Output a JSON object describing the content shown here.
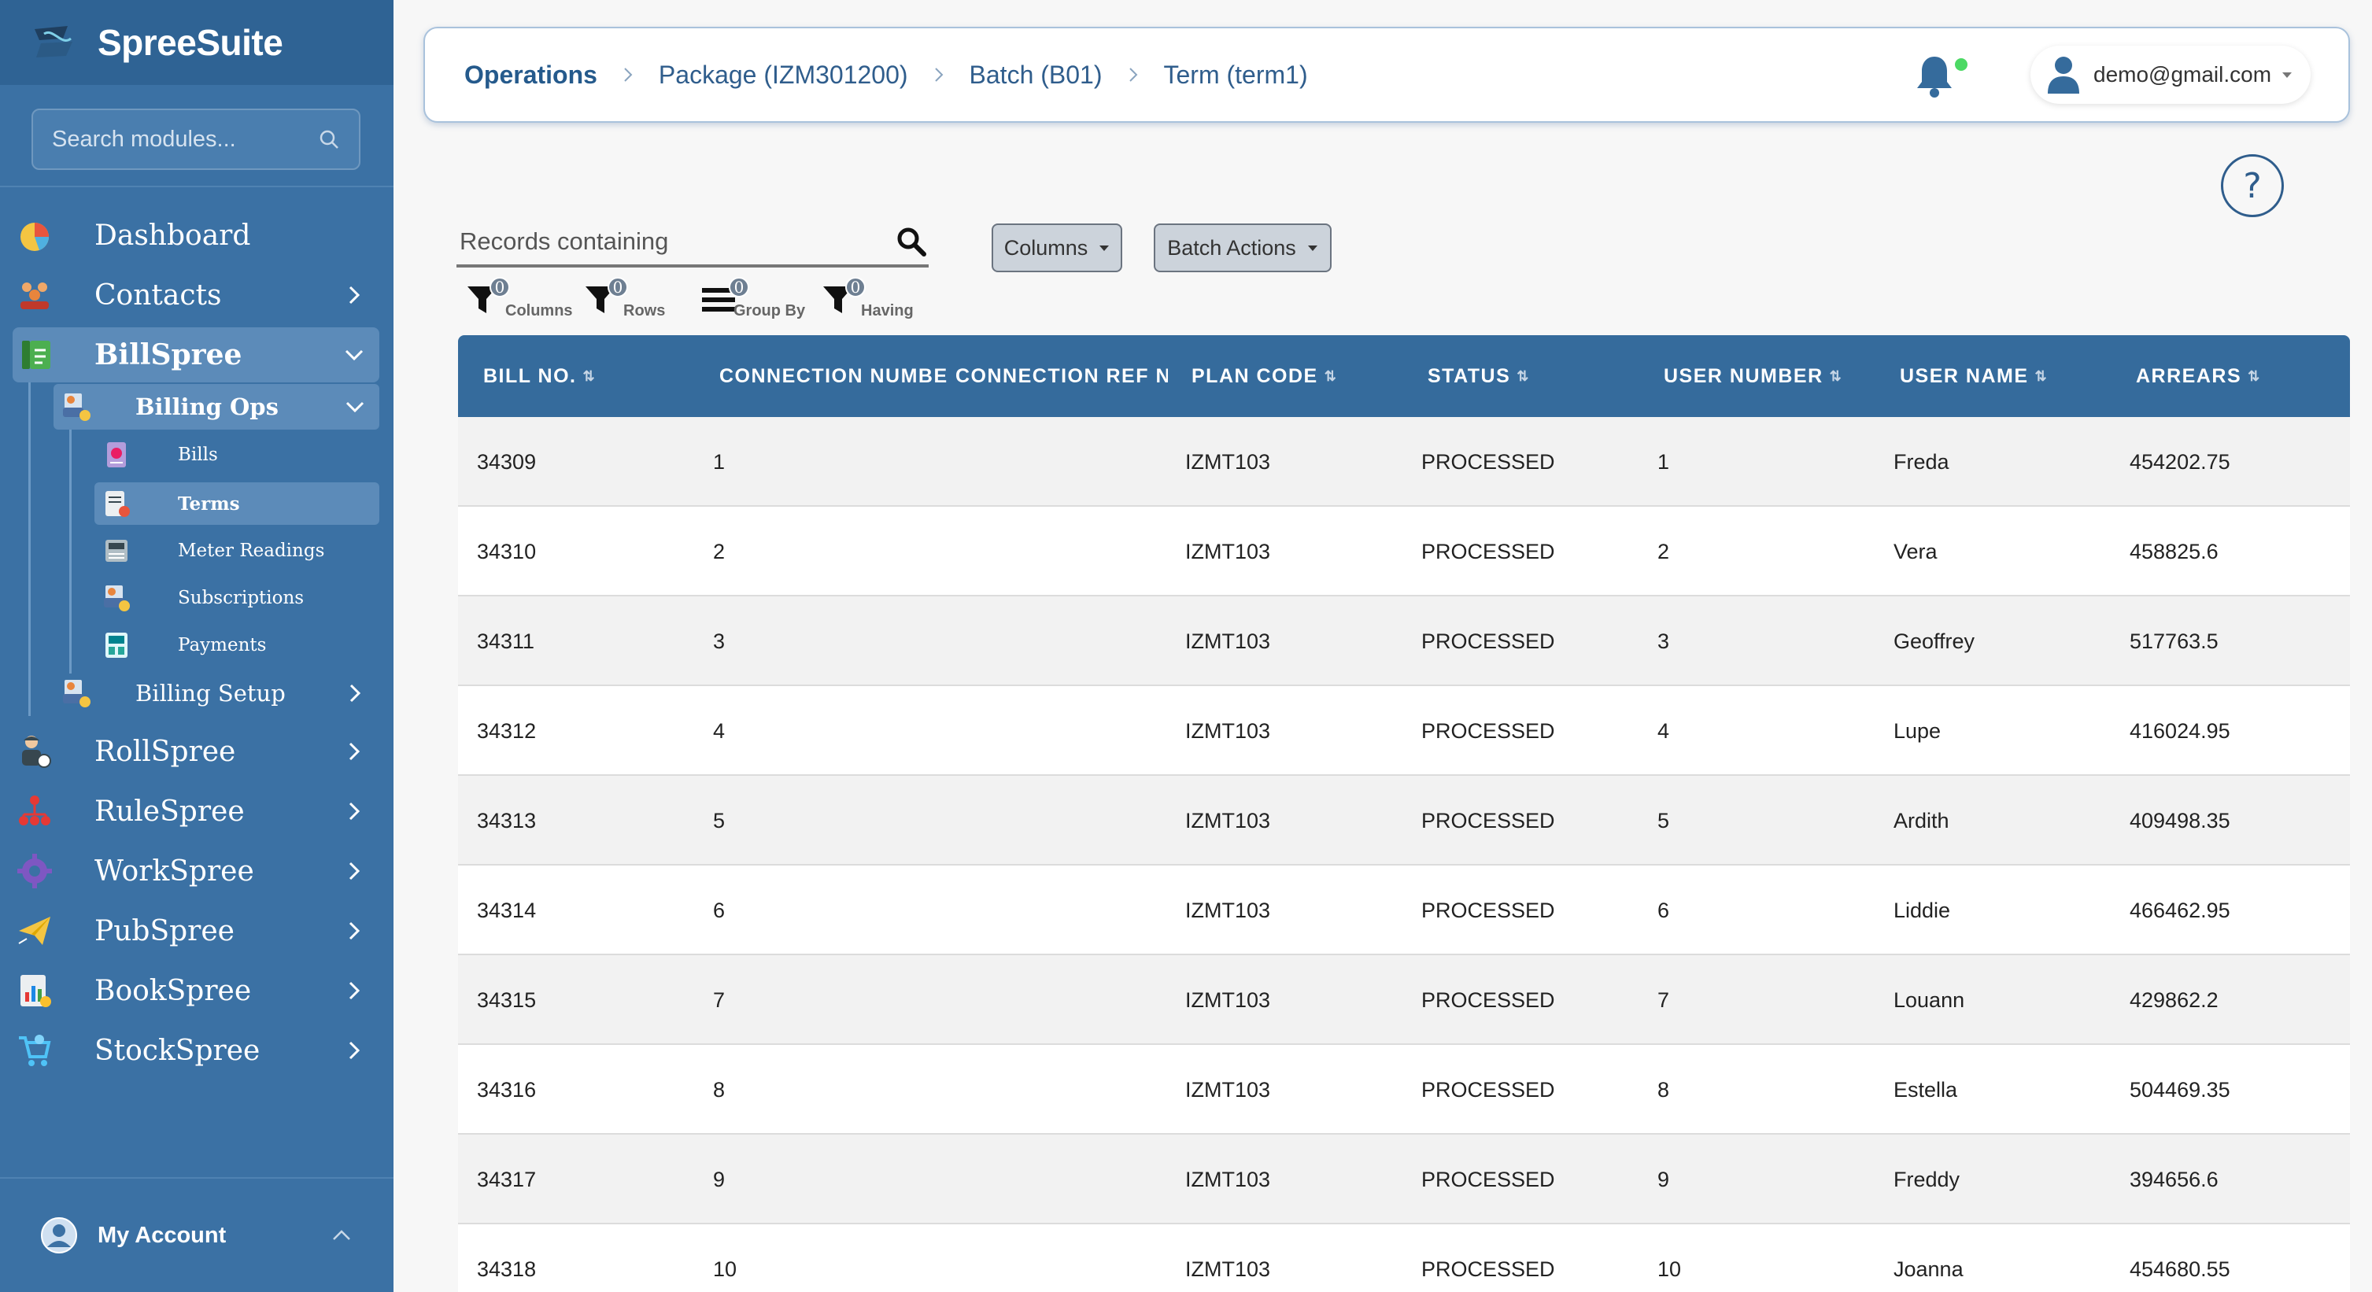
{
  "app": {
    "name": "SpreeSuite"
  },
  "sidebar": {
    "search_placeholder": "Search modules...",
    "items": [
      {
        "label": "Dashboard",
        "icon": "pie-chart-icon",
        "expandable": false
      },
      {
        "label": "Contacts",
        "icon": "people-icon",
        "expandable": true
      },
      {
        "label": "BillSpree",
        "icon": "bill-document-icon",
        "expandable": true,
        "expanded": true
      },
      {
        "label": "RollSpree",
        "icon": "user-roll-icon",
        "expandable": true
      },
      {
        "label": "RuleSpree",
        "icon": "hierarchy-icon",
        "expandable": true
      },
      {
        "label": "WorkSpree",
        "icon": "gear-team-icon",
        "expandable": true
      },
      {
        "label": "PubSpree",
        "icon": "paper-plane-icon",
        "expandable": true
      },
      {
        "label": "BookSpree",
        "icon": "ledger-chart-icon",
        "expandable": true
      },
      {
        "label": "StockSpree",
        "icon": "cart-icon",
        "expandable": true
      }
    ],
    "billspree_children": [
      {
        "label": "Billing Ops",
        "icon": "billing-ops-icon",
        "expanded": true
      },
      {
        "label": "Billing Setup",
        "icon": "billing-setup-icon",
        "expanded": false
      }
    ],
    "billing_ops_children": [
      {
        "label": "Bills",
        "icon": "bills-icon"
      },
      {
        "label": "Terms",
        "icon": "terms-icon",
        "active": true
      },
      {
        "label": "Meter Readings",
        "icon": "meter-icon"
      },
      {
        "label": "Subscriptions",
        "icon": "subscriptions-icon"
      },
      {
        "label": "Payments",
        "icon": "payments-icon"
      }
    ],
    "account_label": "My Account"
  },
  "header": {
    "breadcrumbs": [
      "Operations",
      "Package (IZM301200)",
      "Batch (B01)",
      "Term (term1)"
    ],
    "user_email": "demo@gmail.com",
    "help_symbol": "?"
  },
  "toolbar": {
    "search_placeholder": "Records containing",
    "columns_button": "Columns",
    "batch_actions_button": "Batch Actions",
    "filters": [
      {
        "label": "Columns",
        "count": "0",
        "icon": "filter-icon"
      },
      {
        "label": "Rows",
        "count": "0",
        "icon": "filter-icon"
      },
      {
        "label": "Group By",
        "count": "0",
        "icon": "list-icon"
      },
      {
        "label": "Having",
        "count": "0",
        "icon": "filter-icon"
      }
    ]
  },
  "table": {
    "columns": [
      "BILL NO.",
      "CONNECTION NUMBER",
      "CONNECTION REF NO",
      "PLAN CODE",
      "STATUS",
      "USER NUMBER",
      "USER NAME",
      "ARREARS"
    ],
    "sortable": [
      true,
      false,
      false,
      true,
      true,
      true,
      true,
      true
    ],
    "rows": [
      [
        "34309",
        "1",
        "",
        "IZMT103",
        "PROCESSED",
        "1",
        "Freda",
        "454202.75"
      ],
      [
        "34310",
        "2",
        "",
        "IZMT103",
        "PROCESSED",
        "2",
        "Vera",
        "458825.6"
      ],
      [
        "34311",
        "3",
        "",
        "IZMT103",
        "PROCESSED",
        "3",
        "Geoffrey",
        "517763.5"
      ],
      [
        "34312",
        "4",
        "",
        "IZMT103",
        "PROCESSED",
        "4",
        "Lupe",
        "416024.95"
      ],
      [
        "34313",
        "5",
        "",
        "IZMT103",
        "PROCESSED",
        "5",
        "Ardith",
        "409498.35"
      ],
      [
        "34314",
        "6",
        "",
        "IZMT103",
        "PROCESSED",
        "6",
        "Liddie",
        "466462.95"
      ],
      [
        "34315",
        "7",
        "",
        "IZMT103",
        "PROCESSED",
        "7",
        "Louann",
        "429862.2"
      ],
      [
        "34316",
        "8",
        "",
        "IZMT103",
        "PROCESSED",
        "8",
        "Estella",
        "504469.35"
      ],
      [
        "34317",
        "9",
        "",
        "IZMT103",
        "PROCESSED",
        "9",
        "Freddy",
        "394656.6"
      ],
      [
        "34318",
        "10",
        "",
        "IZMT103",
        "PROCESSED",
        "10",
        "Joanna",
        "454680.55"
      ]
    ]
  },
  "colors": {
    "sidebar_bg": "#3b71a4",
    "sidebar_brand_bg": "#2f6394",
    "sidebar_active": "#5c8bb9",
    "table_header": "#356b9c",
    "breadcrumb": "#255a8c",
    "notification_dot": "#4cd964"
  }
}
